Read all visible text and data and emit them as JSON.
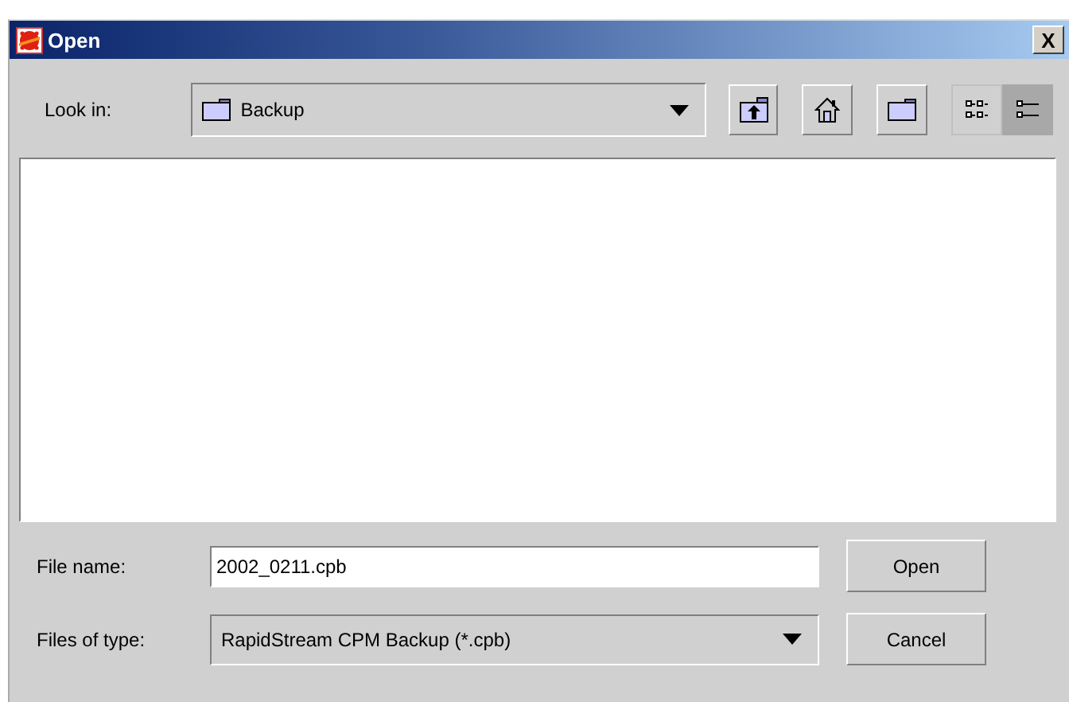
{
  "window": {
    "title": "Open",
    "close_label": "X"
  },
  "look_in": {
    "label": "Look in:",
    "value": "Backup"
  },
  "view_buttons": [
    {
      "kind": "list",
      "selected": false
    },
    {
      "kind": "details",
      "selected": true
    }
  ],
  "file_name": {
    "label": "File name:",
    "value": "2002_0211.cpb"
  },
  "file_type": {
    "label": "Files of type:",
    "value": "RapidStream CPM Backup (*.cpb)"
  },
  "buttons": [
    "Open",
    "Cancel"
  ]
}
